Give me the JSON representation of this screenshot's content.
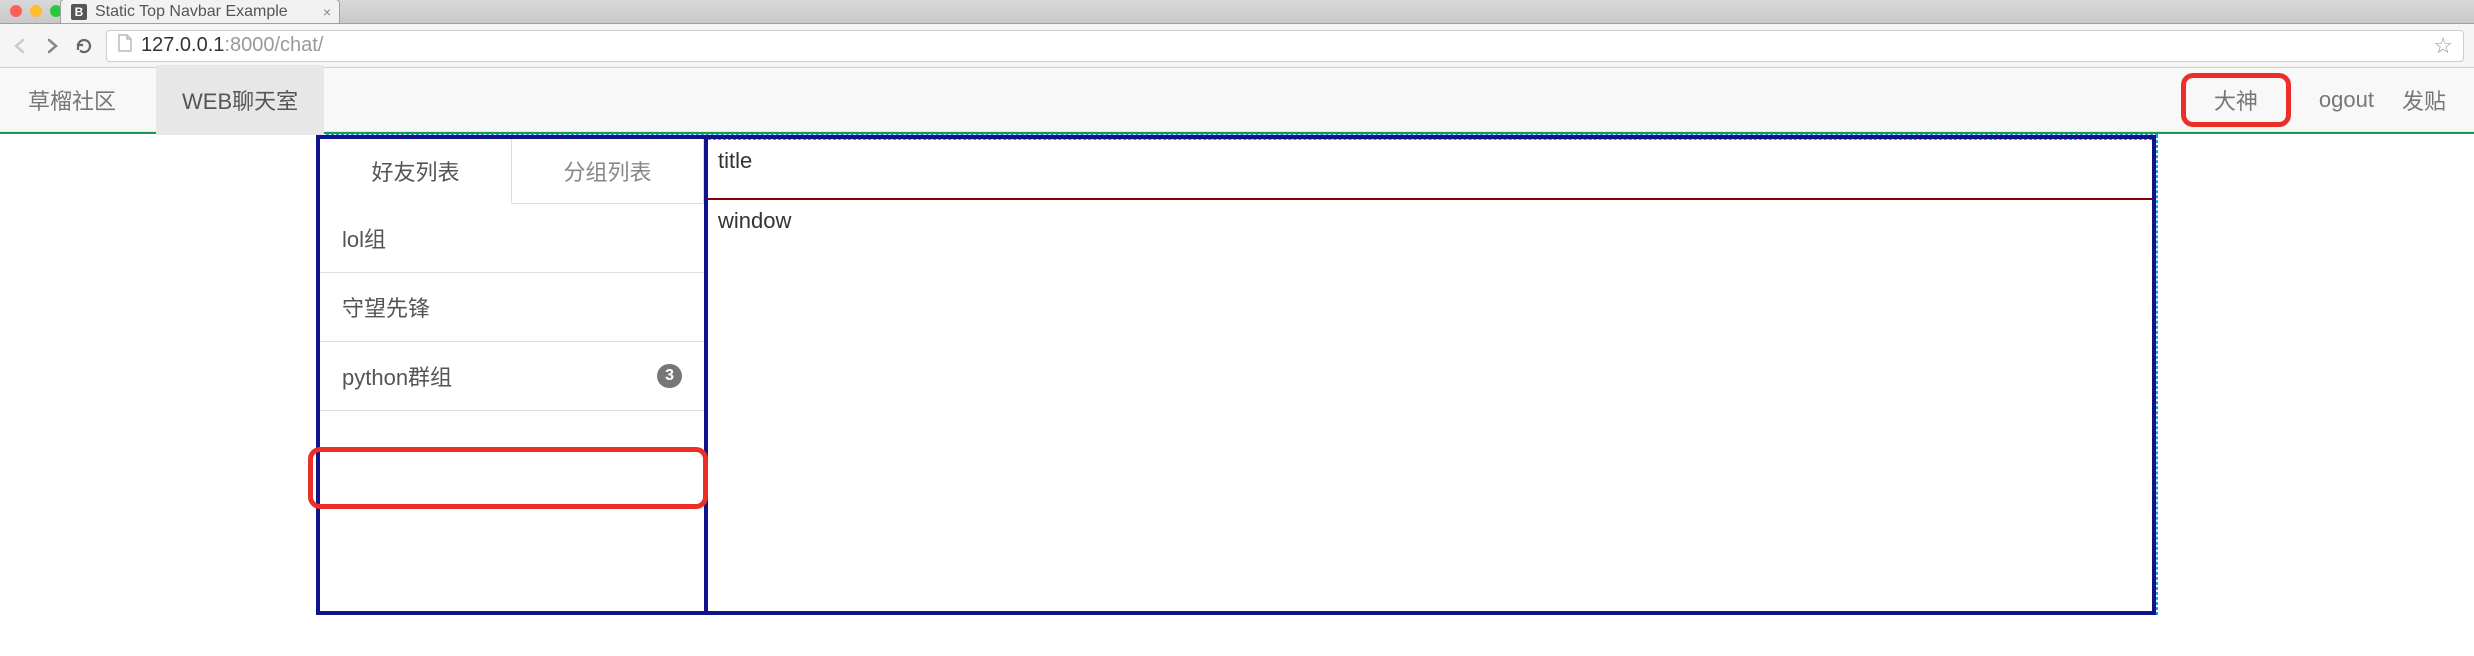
{
  "browser": {
    "tab_title": "Static Top Navbar Example",
    "tab_favicon_letter": "B",
    "url_host": "127.0.0.1",
    "url_port_path": ":8000/chat/"
  },
  "navbar": {
    "brand": "草榴社区",
    "active_item": "WEB聊天室",
    "right": {
      "user": "大神",
      "logout": "ogout",
      "post": "发贴"
    }
  },
  "sidebar": {
    "tabs": {
      "friends": "好友列表",
      "groups": "分组列表"
    },
    "items": [
      {
        "label": "lol组",
        "badge": ""
      },
      {
        "label": "守望先锋",
        "badge": ""
      },
      {
        "label": "python群组",
        "badge": "3"
      }
    ]
  },
  "main": {
    "title": "title",
    "window": "window"
  }
}
